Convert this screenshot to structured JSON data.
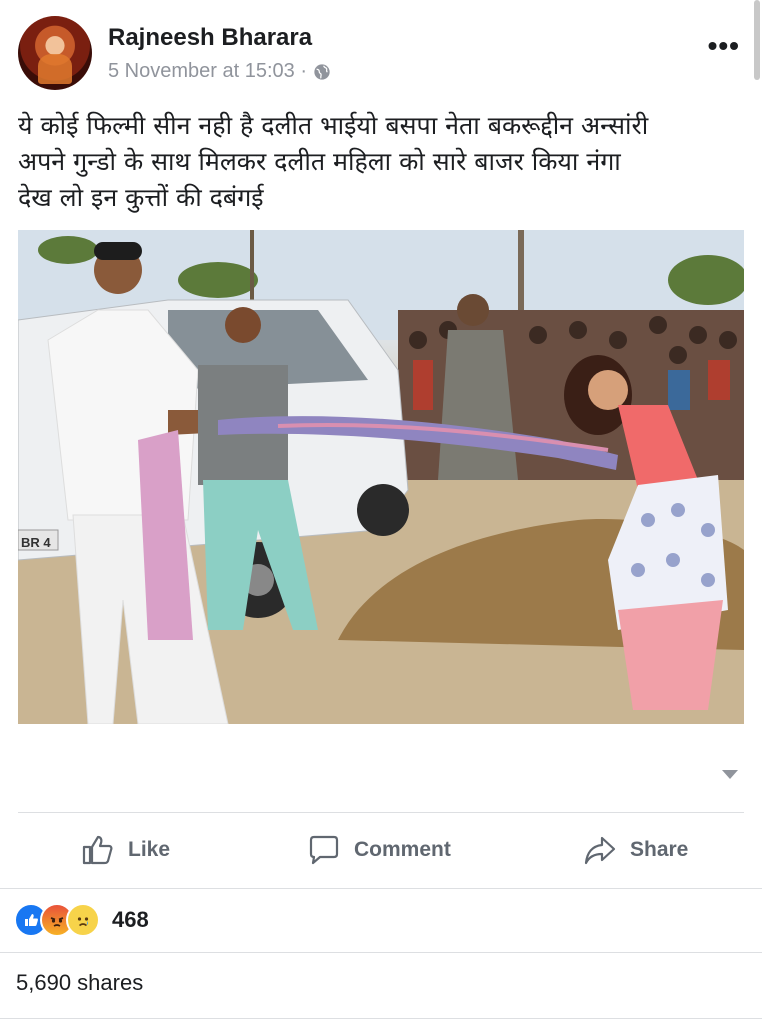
{
  "post": {
    "author": "Rajneesh Bharara",
    "timestamp": "5 November at 15:03 ·",
    "more_label": "•••",
    "text_lines": [
      "ये कोई फिल्मी सीन नही है दलीत भाईयो बसपा नेता बकरूद्दीन अन्सांरी",
      "अपने गुन्डो के साथ मिलकर दलीत महिला को सारे बाजर किया नंगा",
      "देख लो इन कुत्तों की दबंगई"
    ]
  },
  "photo": {
    "plate_text": "BR 4"
  },
  "actions": {
    "like": "Like",
    "comment": "Comment",
    "share": "Share"
  },
  "stats": {
    "reaction_count": "468",
    "shares": "5,690 shares"
  },
  "icons": {
    "privacy": "globe-icon",
    "like": "thumbs-up-icon",
    "comment": "comment-bubble-icon",
    "share": "share-arrow-icon",
    "expand": "caret-down-icon"
  },
  "colors": {
    "accent": "#1877f2",
    "secondary_text": "#90949c",
    "action_text": "#606770"
  }
}
